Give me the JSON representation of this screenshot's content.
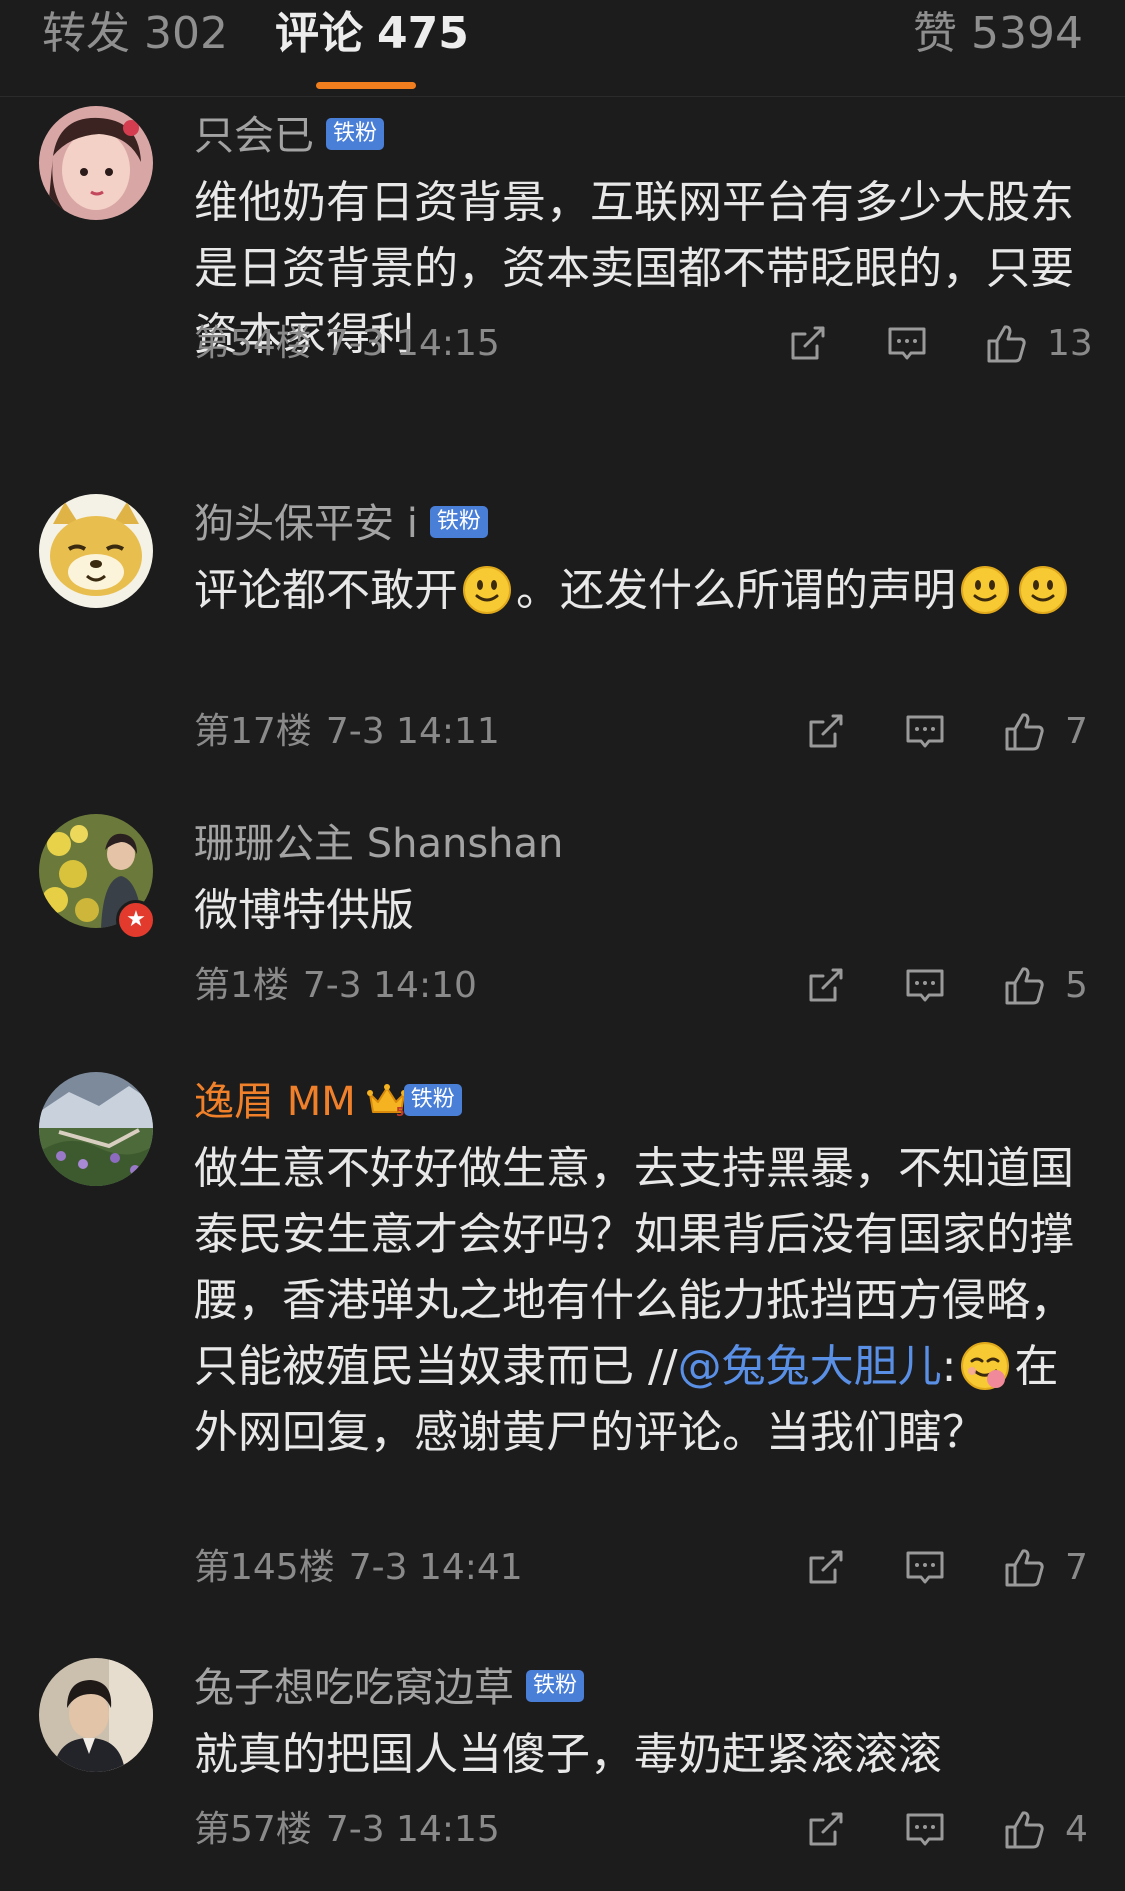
{
  "tabs": {
    "forward": {
      "label": "转发",
      "count": "302"
    },
    "comments": {
      "label": "评论",
      "count": "475"
    },
    "likes": {
      "label": "赞",
      "count": "5394"
    }
  },
  "colors": {
    "background": "#1c1c1c",
    "accent": "#f07e1f",
    "mention": "#5a8fe6",
    "fan_badge": "#4a7fd8",
    "vip_name": "#f0812a"
  },
  "comments": [
    {
      "username": "只会已",
      "badge": "铁粉",
      "content": "维他奶有日资背景，互联网平台有多少大股东是日资背景的，资本卖国都不带眨眼的，只要资本家得利",
      "floor": "第54楼",
      "time": "7-3 14:15",
      "likes": "13"
    },
    {
      "username": "狗头保平安 i",
      "badge": "铁粉",
      "content_1": "评论都不敢开",
      "content_2": "。还发什么所谓的声明",
      "floor": "第17楼",
      "time": "7-3 14:11",
      "likes": "7",
      "emoji": "smile-emoji"
    },
    {
      "username": "珊珊公主 Shanshan",
      "content": "微博特供版",
      "floor": "第1楼",
      "time": "7-3 14:10",
      "likes": "5"
    },
    {
      "username": "逸眉 MM",
      "badge": "铁粉",
      "vip_level": "5",
      "content_1": "做生意不好好做生意，去支持黑暴，不知道国泰民安生意才会好吗？如果背后没有国家的撑腰，香港弹丸之地有什么能力抵挡西方侵略，只能被殖民当奴隶而已 //",
      "mention": "@兔兔大胆儿",
      "content_2": ":",
      "content_3": "在外网回复，感谢黄尸的评论。当我们瞎？",
      "floor": "第145楼",
      "time": "7-3 14:41",
      "likes": "7",
      "emoji": "smirk-emoji"
    },
    {
      "username": "兔子想吃吃窝边草",
      "badge": "铁粉",
      "content": "就真的把国人当傻子，毒奶赶紧滚滚滚",
      "floor": "第57楼",
      "time": "7-3 14:15",
      "likes": "4"
    }
  ]
}
